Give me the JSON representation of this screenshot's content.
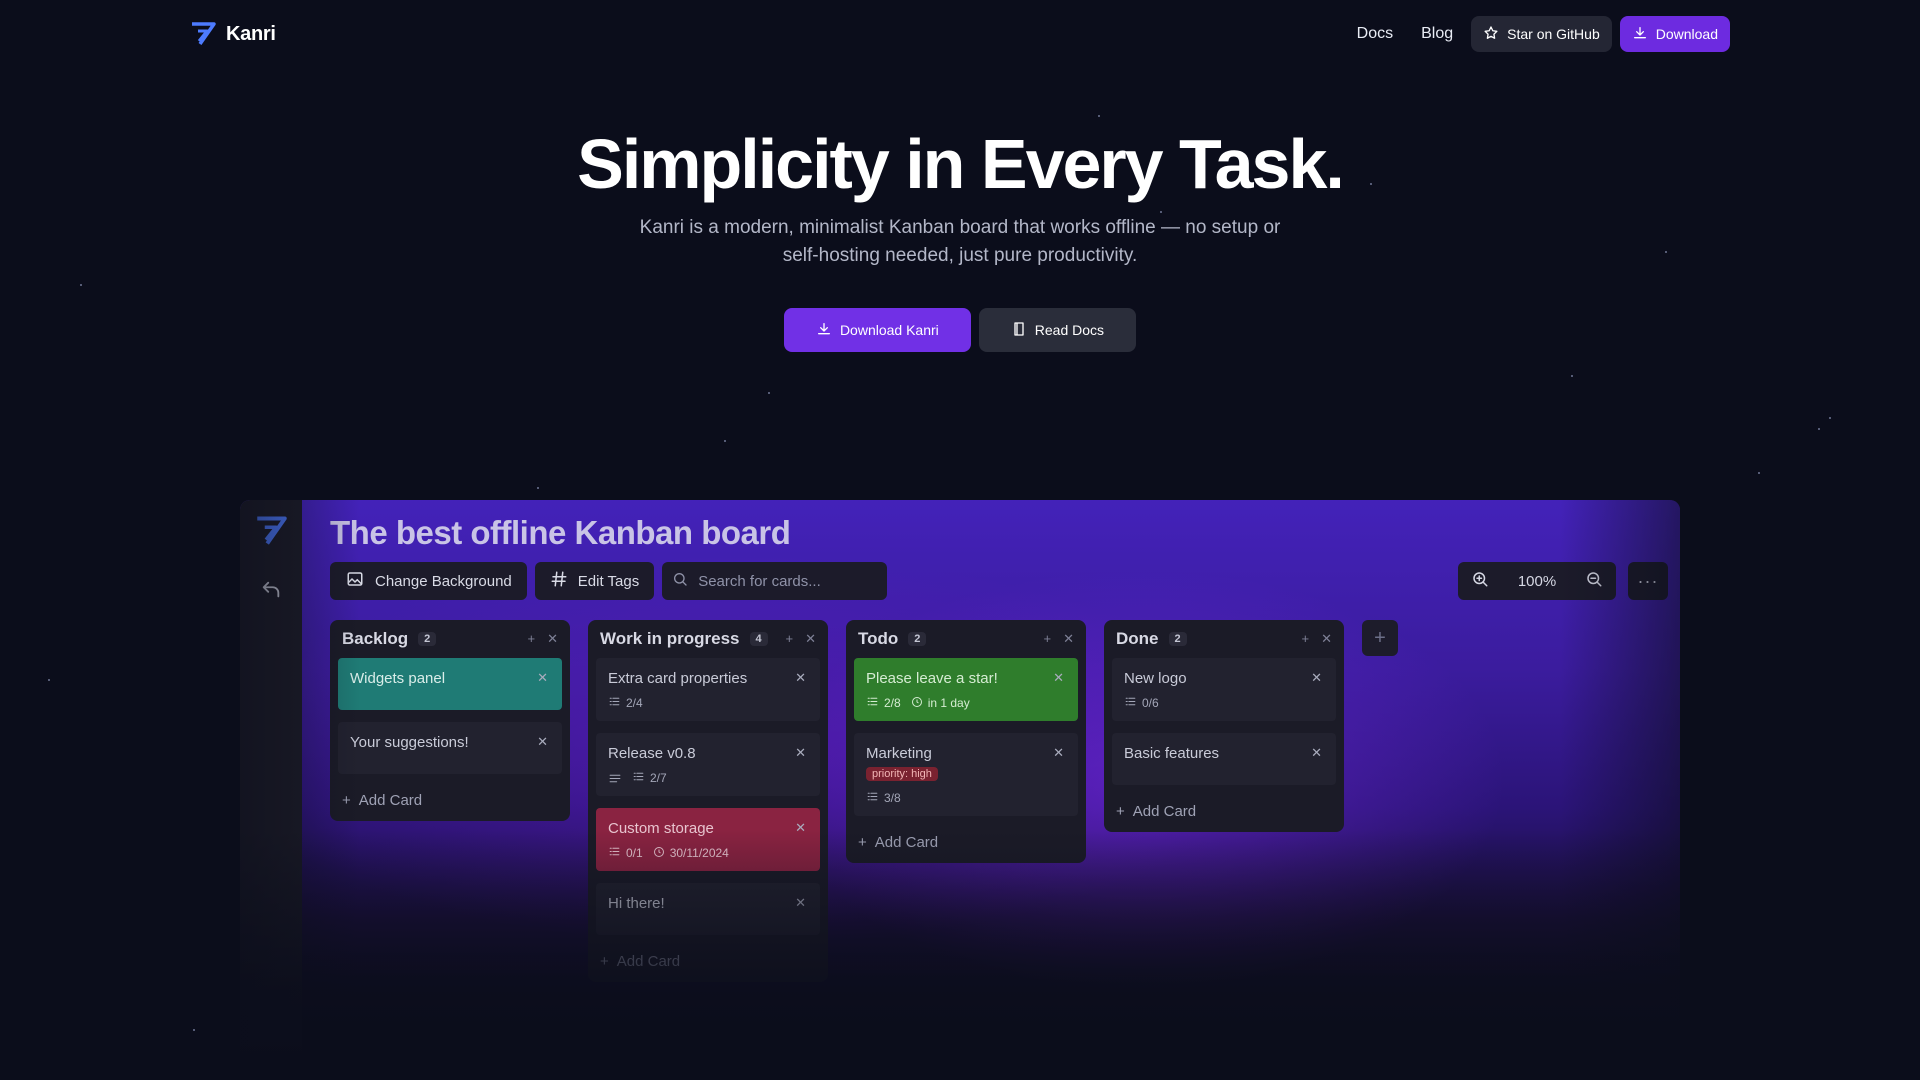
{
  "nav": {
    "brand": "Kanri",
    "links": [
      "Docs",
      "Blog"
    ],
    "github_label": "Star on GitHub",
    "download_label": "Download",
    "accent": "#6d2be0"
  },
  "hero": {
    "title": "Simplicity in Every Task.",
    "subtitle": "Kanri is a modern, minimalist Kanban board that works offline — no setup or self-hosting needed, just pure productivity.",
    "primary_label": "Download Kanri",
    "secondary_label": "Read Docs"
  },
  "app": {
    "board_title": "The best offline Kanban board",
    "toolbar": {
      "change_background": "Change Background",
      "edit_tags": "Edit Tags",
      "search_placeholder": "Search for cards..."
    },
    "zoom": "100%",
    "more": "···",
    "add_card_label": "Add Card",
    "columns": [
      {
        "name": "Backlog",
        "count": "2",
        "cards": [
          {
            "title": "Widgets panel",
            "color": "teal"
          },
          {
            "title": "Your suggestions!"
          }
        ]
      },
      {
        "name": "Work in progress",
        "count": "4",
        "cards": [
          {
            "title": "Extra card properties",
            "tasks": "2/4"
          },
          {
            "title": "Release v0.8",
            "has_description": true,
            "tasks": "2/7"
          },
          {
            "title": "Custom storage",
            "color": "red",
            "tasks": "0/1",
            "due": "30/11/2024"
          },
          {
            "title": "Hi there!"
          }
        ]
      },
      {
        "name": "Todo",
        "count": "2",
        "cards": [
          {
            "title": "Please leave a star!",
            "color": "green",
            "tasks": "2/8",
            "due": "in 1 day"
          },
          {
            "title": "Marketing",
            "tag": "priority: high",
            "tasks": "3/8"
          }
        ]
      },
      {
        "name": "Done",
        "count": "2",
        "cards": [
          {
            "title": "New logo",
            "tasks": "0/6"
          },
          {
            "title": "Basic features"
          }
        ]
      }
    ]
  }
}
